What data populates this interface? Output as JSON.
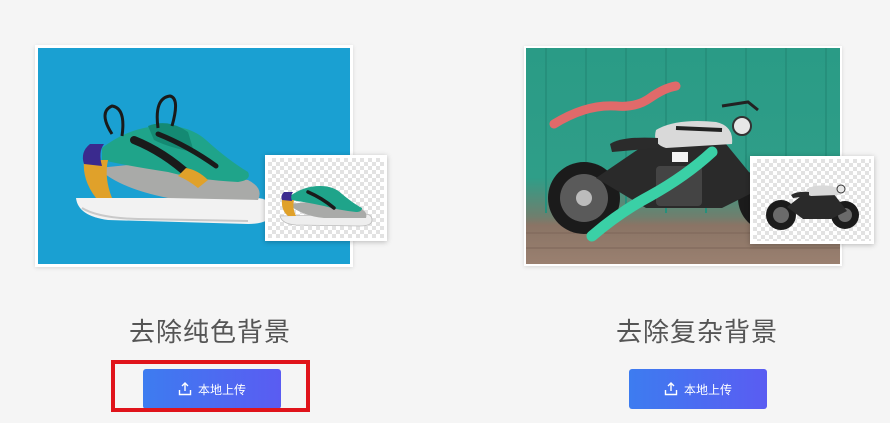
{
  "cards": [
    {
      "title": "去除纯色背景",
      "button_label": "本地上传",
      "button_icon": "upload-icon",
      "photo_background_color": "#1aa0d2",
      "subject": "sneaker"
    },
    {
      "title": "去除复杂背景",
      "button_label": "本地上传",
      "button_icon": "upload-icon",
      "photo_background_color": "#2a9b86",
      "subject": "motorcycle"
    }
  ],
  "colors": {
    "button_gradient_start": "#3d7cf0",
    "button_gradient_end": "#5a5cf2",
    "highlight": "#e0141b",
    "page_background": "#f5f5f5",
    "title_text": "#555555"
  }
}
